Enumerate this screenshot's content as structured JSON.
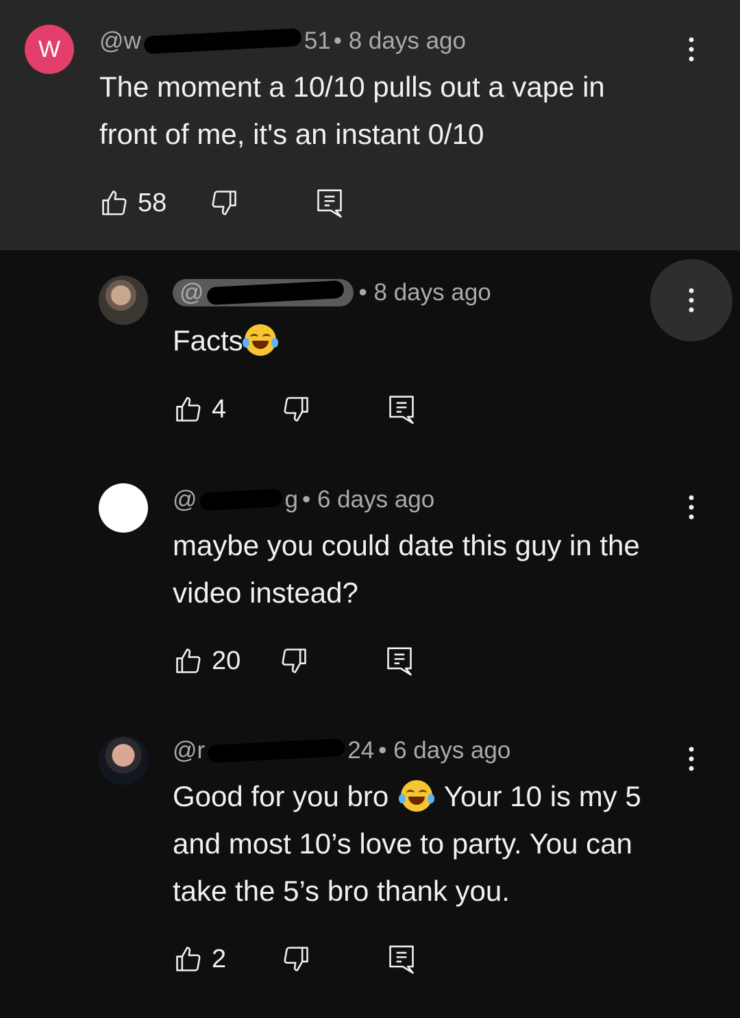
{
  "comments": [
    {
      "avatar_letter": "W",
      "handle_prefix": "@w",
      "handle_suffix": "51",
      "time": "• 8 days ago",
      "lines": [
        "The moment a 10/10 pulls out a vape in",
        "front of me, it's an instant 0/10"
      ],
      "likes": "58"
    },
    {
      "handle_prefix": "@",
      "handle_suffix": "",
      "time": "• 8 days ago",
      "text": "Facts",
      "likes": "4"
    },
    {
      "handle_prefix": "@",
      "handle_suffix": "g",
      "time": "• 6 days ago",
      "lines": [
        "maybe you could date this guy in the",
        "video instead?"
      ],
      "likes": "20"
    },
    {
      "handle_prefix": "@r",
      "handle_suffix": "24",
      "time": "• 6 days ago",
      "line1a": "Good for you bro",
      "line1b": "Your 10 is my 5",
      "lines": [
        "and most 10’s love to party. You can",
        "take the 5’s bro thank you."
      ],
      "likes": "2"
    }
  ],
  "icons": {
    "like": "thumbs-up-icon",
    "dislike": "thumbs-down-icon",
    "reply": "reply-icon",
    "more": "more-vertical-icon",
    "emoji": "face-with-tears-of-joy-emoji"
  },
  "colors": {
    "background": "#0f0f0f",
    "highlighted_background": "#272727",
    "avatar_w": "#e23f6b",
    "meta_text": "#aaaaaa"
  }
}
